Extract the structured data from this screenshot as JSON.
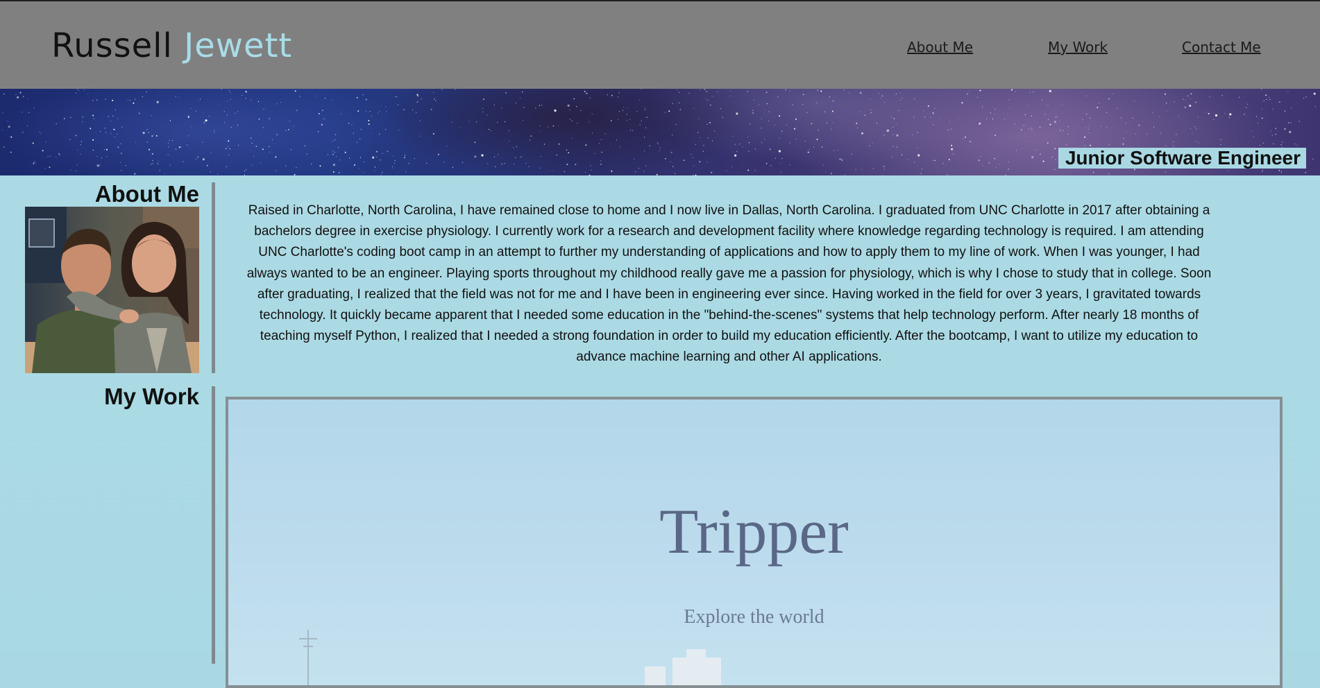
{
  "header": {
    "brand_first": "Russell",
    "brand_last": "Jewett",
    "nav": [
      {
        "label": "About Me"
      },
      {
        "label": "My Work"
      },
      {
        "label": "Contact Me"
      }
    ]
  },
  "banner": {
    "tagline": "Junior Software Engineer"
  },
  "about": {
    "title": "About Me",
    "photo_icon": "profile-photo",
    "text": "Raised in Charlotte, North Carolina, I have remained close to home and I now live in Dallas, North Carolina. I graduated from UNC Charlotte in 2017 after obtaining a bachelors degree in exercise physiology. I currently work for a research and development facility where knowledge regarding technology is required. I am attending UNC Charlotte's coding boot camp in an attempt to further my understanding of applications and how to apply them to my line of work. When I was younger, I had always wanted to be an engineer. Playing sports throughout my childhood really gave me a passion for physiology, which is why I chose to study that in college. Soon after graduating, I realized that the field was not for me and I have been in engineering ever since. Having worked in the field for over 3 years, I gravitated towards technology. It quickly became apparent that I needed some education in the \"behind-the-scenes\" systems that help technology perform. After nearly 18 months of teaching myself Python, I realized that I needed a strong foundation in order to build my education efficiently. After the bootcamp, I want to utilize my education to advance machine learning and other AI applications."
  },
  "work": {
    "title": "My Work",
    "projects": [
      {
        "title": "Tripper",
        "subtitle": "Explore the world"
      }
    ]
  },
  "colors": {
    "header_bg": "#808080",
    "page_bg": "#a9d8e3",
    "brand_accent": "#a8dce8",
    "divider": "#7f8a8e"
  }
}
